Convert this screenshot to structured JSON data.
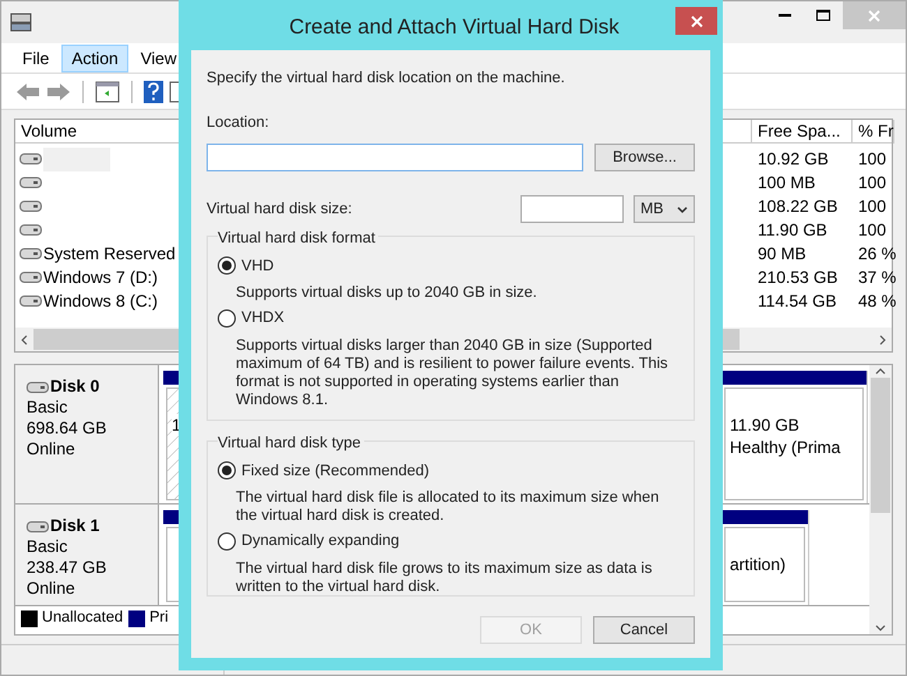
{
  "main_window": {
    "menu": [
      {
        "label": "File",
        "selected": false
      },
      {
        "label": "Action",
        "selected": true
      },
      {
        "label": "View",
        "selected": false
      }
    ],
    "volume_table": {
      "columns": [
        "Volume",
        "Free Spa...",
        "% Fr"
      ],
      "rows": [
        {
          "free_space": "10.92 GB",
          "percent_free": "100",
          "selected": true
        },
        {
          "free_space": "100 MB",
          "percent_free": "100",
          "selected": false
        },
        {
          "free_space": "108.22 GB",
          "percent_free": "100",
          "selected": false
        },
        {
          "free_space": "11.90 GB",
          "percent_free": "100",
          "selected": false
        },
        {
          "volume": "System Reserved",
          "free_space": "90 MB",
          "percent_free": "26 %",
          "selected": false
        },
        {
          "volume": "Windows 7 (D:)",
          "free_space": "210.53 GB",
          "percent_free": "37 %",
          "selected": false
        },
        {
          "volume": "Windows 8 (C:)",
          "free_space": "114.54 GB",
          "percent_free": "48 %",
          "selected": false
        }
      ]
    },
    "disks": [
      {
        "name": "Disk 0",
        "type": "Basic",
        "size": "698.64 GB",
        "status": "Online",
        "partitions": [
          {
            "lines": [
              "1"
            ],
            "hatched": true
          },
          {
            "lines": [
              "11.90 GB",
              "Healthy (Prima"
            ],
            "hatched": false
          }
        ]
      },
      {
        "name": "Disk 1",
        "type": "Basic",
        "size": "238.47 GB",
        "status": "Online",
        "partitions": [
          {
            "hatched": false
          },
          {
            "lines": [
              "artition)"
            ],
            "hatched": false
          }
        ]
      }
    ],
    "legend": [
      {
        "label": "Unallocated",
        "color": "#000000"
      },
      {
        "label": "Pri",
        "color": "#000080"
      }
    ]
  },
  "dialog": {
    "title": "Create and Attach Virtual Hard Disk",
    "intro": "Specify the virtual hard disk location on the machine.",
    "location_label": "Location:",
    "browse_button": "Browse...",
    "size_label": "Virtual hard disk size:",
    "size_unit": "MB",
    "groups": [
      {
        "title": "Virtual hard disk format",
        "options": [
          {
            "label": "VHD",
            "description": "Supports virtual disks up to 2040 GB in size.",
            "selected": true
          },
          {
            "label": "VHDX",
            "description": "Supports virtual disks larger than 2040 GB in size (Supported maximum of 64 TB) and is resilient to power failure events. This format is not supported in operating systems earlier than Windows 8.1.",
            "selected": false
          }
        ]
      },
      {
        "title": "Virtual hard disk type",
        "options": [
          {
            "label": "Fixed size (Recommended)",
            "description": "The virtual hard disk file is allocated to its maximum size when the virtual hard disk is created.",
            "selected": true
          },
          {
            "label": "Dynamically expanding",
            "description": "The virtual hard disk file grows to its maximum size as data is written to the virtual hard disk.",
            "selected": false
          }
        ]
      }
    ],
    "buttons": [
      {
        "label": "OK",
        "disabled": true
      },
      {
        "label": "Cancel",
        "disabled": false
      }
    ]
  }
}
